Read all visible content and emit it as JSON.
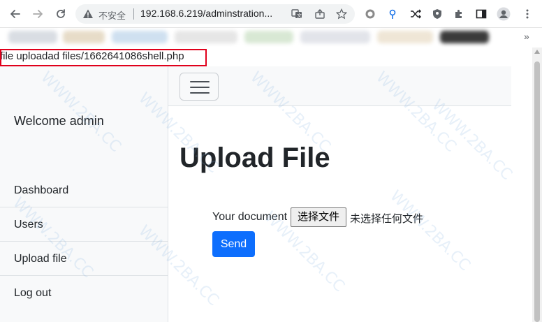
{
  "browser": {
    "insecure_label": "不安全",
    "url": "192.168.6.219/adminstration...",
    "more_bookmarks": "»"
  },
  "echo": {
    "text": "file uploadad files/1662641086shell.php"
  },
  "sidebar": {
    "welcome": "Welcome admin",
    "items": [
      {
        "label": "Dashboard"
      },
      {
        "label": "Users"
      },
      {
        "label": "Upload file"
      },
      {
        "label": "Log out"
      }
    ]
  },
  "main": {
    "title": "Upload File",
    "form": {
      "document_label": "Your document",
      "choose_file_label": "选择文件",
      "file_status": "未选择任何文件",
      "send_label": "Send"
    }
  },
  "watermark": {
    "text": "WWW.2BA.CC"
  },
  "colors": {
    "accent": "#0d6efd",
    "highlight_box": "#e0001b",
    "sidebar_bg": "#f8f9fa"
  }
}
